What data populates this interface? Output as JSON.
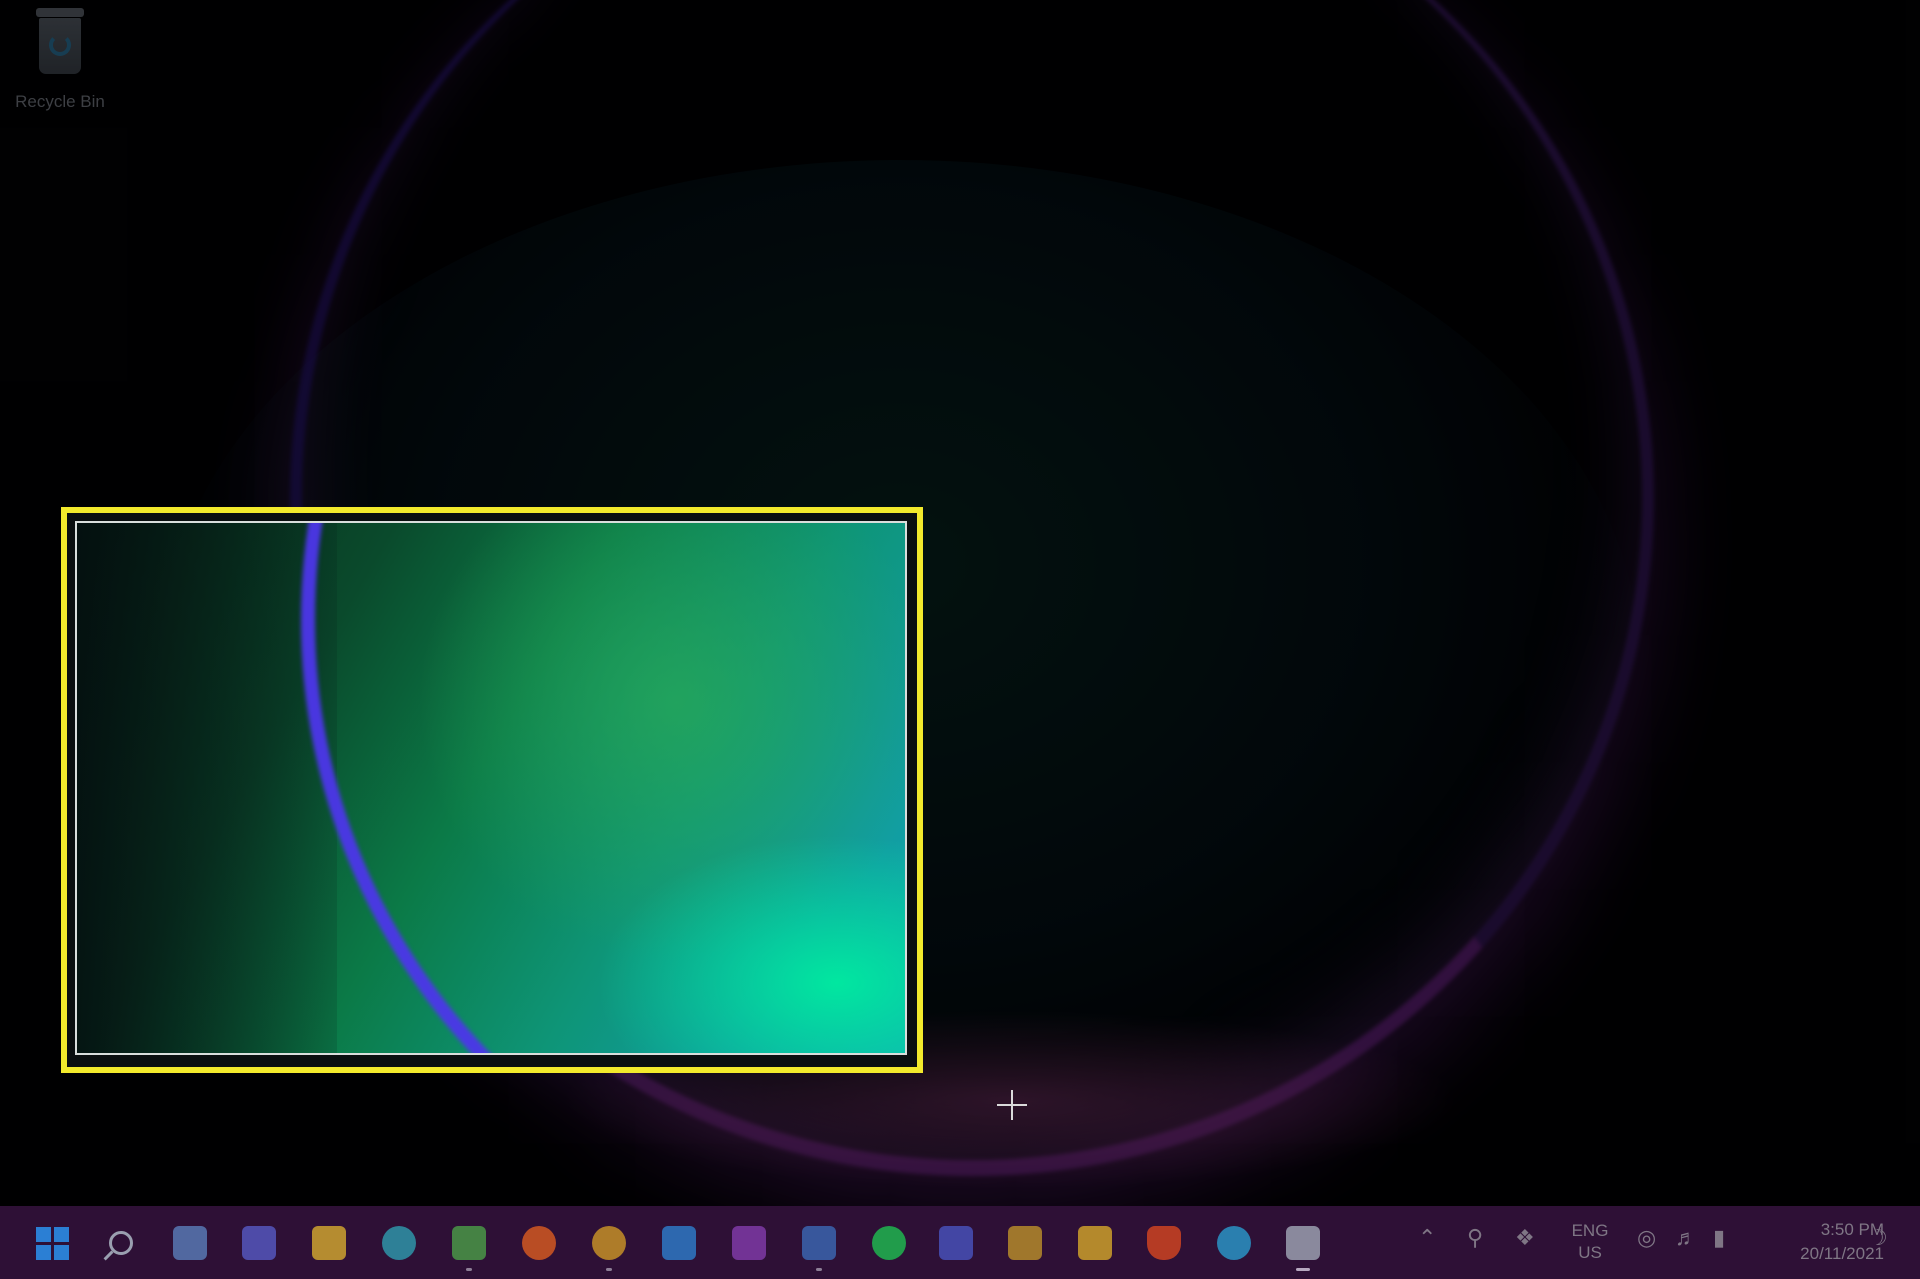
{
  "desktop": {
    "icons": [
      {
        "label": "Recycle Bin",
        "icon": "recycle-bin-icon"
      }
    ]
  },
  "snip": {
    "selection_color": "#f2ea2c",
    "cursor": "crosshair-icon"
  },
  "taskbar": {
    "apps": [
      {
        "icon": "start-icon",
        "color": "#2b7fd4"
      },
      {
        "icon": "search-icon",
        "color": "#9a9fb0"
      },
      {
        "icon": "task-view-icon",
        "color": "#5e86c4"
      },
      {
        "icon": "chat-icon",
        "color": "#5a5fcf"
      },
      {
        "icon": "file-explorer-icon",
        "color": "#e3b62f"
      },
      {
        "icon": "edge-icon",
        "color": "#2fa6b8"
      },
      {
        "icon": "app-icon",
        "color": "#4ea84a"
      },
      {
        "icon": "firefox-icon",
        "color": "#e8621f"
      },
      {
        "icon": "chrome-icon",
        "color": "#d9a026"
      },
      {
        "icon": "todo-icon",
        "color": "#2d86d8"
      },
      {
        "icon": "onenote-icon",
        "color": "#8a3fb5"
      },
      {
        "icon": "word-icon",
        "color": "#3c6fbf"
      },
      {
        "icon": "spotify-icon",
        "color": "#1ecb53"
      },
      {
        "icon": "app-icon",
        "color": "#4b58c9"
      },
      {
        "icon": "microsoft-store-icon",
        "color": "#c79a2a"
      },
      {
        "icon": "app-icon",
        "color": "#e2b22a"
      },
      {
        "icon": "brave-icon",
        "color": "#e3491f"
      },
      {
        "icon": "telegram-icon",
        "color": "#2aa4d8"
      },
      {
        "icon": "snipping-tool-icon",
        "color": "#aab2c0"
      }
    ],
    "tray": {
      "chevron_icon": "chevron-up-icon",
      "icons": [
        "usb-icon",
        "dropbox-icon"
      ],
      "lang_line1": "ENG",
      "lang_line2": "US",
      "status_icons": [
        "wifi-icon",
        "volume-icon",
        "battery-icon"
      ],
      "time": "3:50 PM",
      "date": "20/11/2021",
      "notification_icon": "moon-icon"
    }
  }
}
